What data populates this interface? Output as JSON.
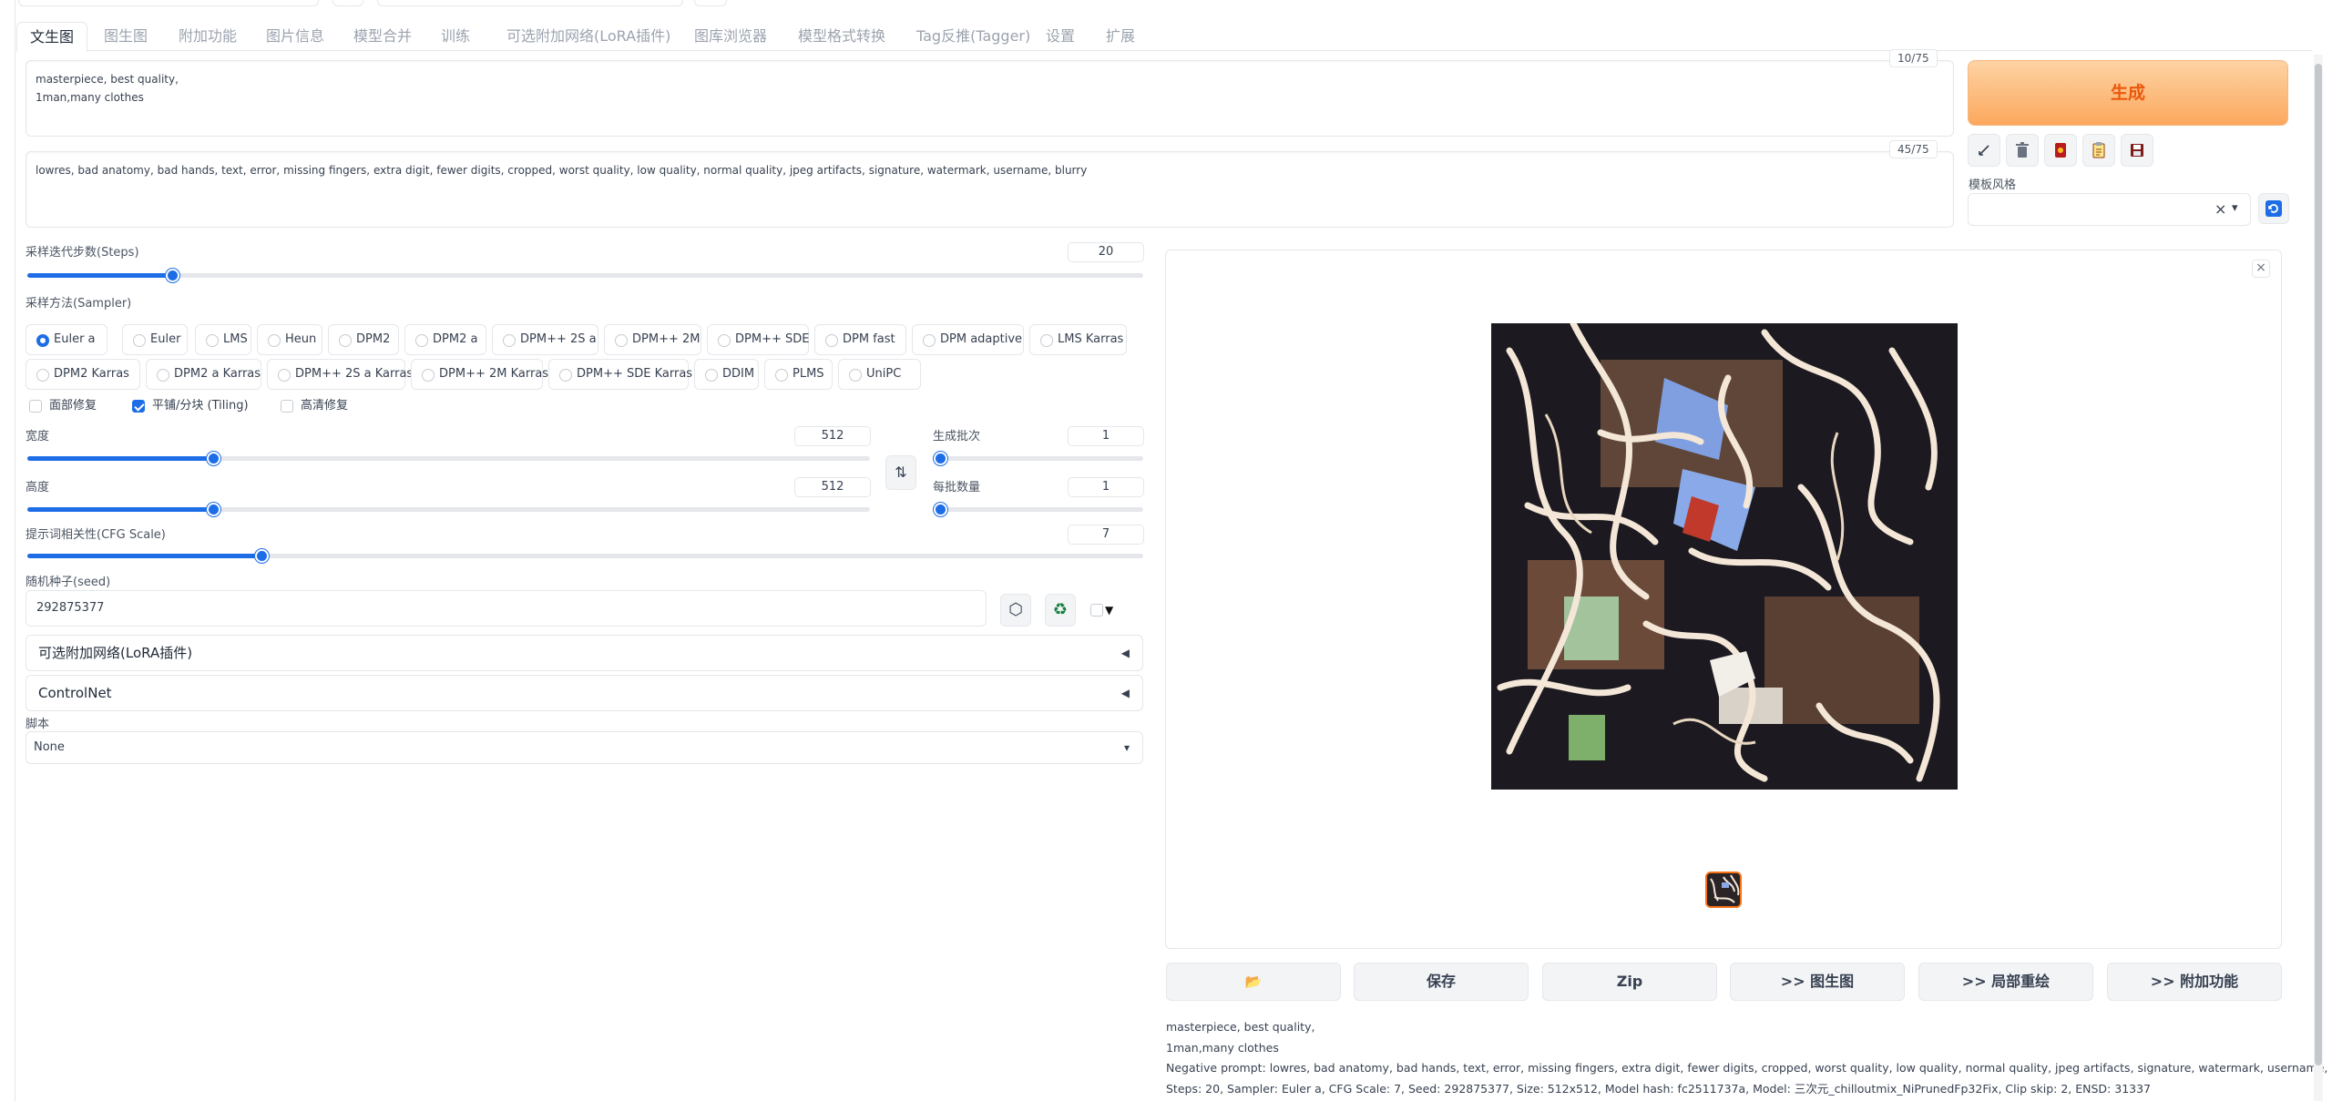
{
  "tabs": [
    "文生图",
    "图生图",
    "附加功能",
    "图片信息",
    "模型合并",
    "训练",
    "可选附加网络(LoRA插件)",
    "图库浏览器",
    "模型格式转换",
    "Tag反推(Tagger)",
    "设置",
    "扩展"
  ],
  "prompt": {
    "positive": "masterpiece, best quality,\n1man,many clothes",
    "positive_counter": "10/75",
    "negative": "lowres, bad anatomy, bad hands, text, error, missing fingers, extra digit, fewer digits, cropped, worst quality, low quality, normal quality, jpeg artifacts, signature, watermark, username, blurry",
    "negative_counter": "45/75"
  },
  "generate_label": "生成",
  "tool_icons": [
    "arrow-check-icon",
    "trash-icon",
    "red-card-icon",
    "clipboard-icon",
    "save-disk-icon"
  ],
  "style": {
    "label": "模板风格",
    "value": "",
    "clear": "×",
    "caret": "▾"
  },
  "steps": {
    "label": "采样迭代步数(Steps)",
    "value": "20",
    "fraction": 0.13
  },
  "sampler": {
    "label": "采样方法(Sampler)",
    "selected": "Euler a",
    "options": [
      "Euler a",
      "Euler",
      "LMS",
      "Heun",
      "DPM2",
      "DPM2 a",
      "DPM++ 2S a",
      "DPM++ 2M",
      "DPM++ SDE",
      "DPM fast",
      "DPM adaptive",
      "LMS Karras",
      "DPM2 Karras",
      "DPM2 a Karras",
      "DPM++ 2S a Karras",
      "DPM++ 2M Karras",
      "DPM++ SDE Karras",
      "DDIM",
      "PLMS",
      "UniPC"
    ]
  },
  "checks": {
    "face": "面部修复",
    "tiling": "平铺/分块 (Tiling)",
    "hires": "高清修复"
  },
  "width": {
    "label": "宽度",
    "value": "512",
    "fraction": 0.22
  },
  "height": {
    "label": "高度",
    "value": "512",
    "fraction": 0.22
  },
  "batch_count": {
    "label": "生成批次",
    "value": "1",
    "fraction": 0.0
  },
  "batch_size": {
    "label": "每批数量",
    "value": "1",
    "fraction": 0.0
  },
  "swap_icon": "⇅",
  "cfg": {
    "label": "提示词相关性(CFG Scale)",
    "value": "7",
    "fraction": 0.21
  },
  "seed": {
    "label": "随机种子(seed)",
    "value": "292875377",
    "dice": "⬡",
    "recycle": "♻",
    "extra_caret": "▼"
  },
  "lora_accordion": "可选附加网络(LoRA插件)",
  "controlnet_accordion": "ControlNet",
  "accordion_arrow": "◀",
  "script": {
    "label": "脚本",
    "value": "None",
    "caret": "▾"
  },
  "gallery": {
    "close": "×"
  },
  "output_buttons": [
    "保存",
    "Zip",
    ">> 图生图",
    ">> 局部重绘",
    ">> 附加功能"
  ],
  "folder_icon": "📂",
  "info_lines": [
    "masterpiece, best quality,",
    "1man,many clothes",
    "Negative prompt: lowres, bad anatomy, bad hands, text, error, missing fingers, extra digit, fewer digits, cropped, worst quality, low quality, normal quality, jpeg artifacts, signature, watermark, username, blurry",
    "Steps: 20, Sampler: Euler a, CFG Scale: 7, Seed: 292875377, Size: 512x512, Model hash: fc2511737a, Model: 三次元_chilloutmix_NiPrunedFp32Fix, Clip skip: 2, ENSD: 31337"
  ]
}
